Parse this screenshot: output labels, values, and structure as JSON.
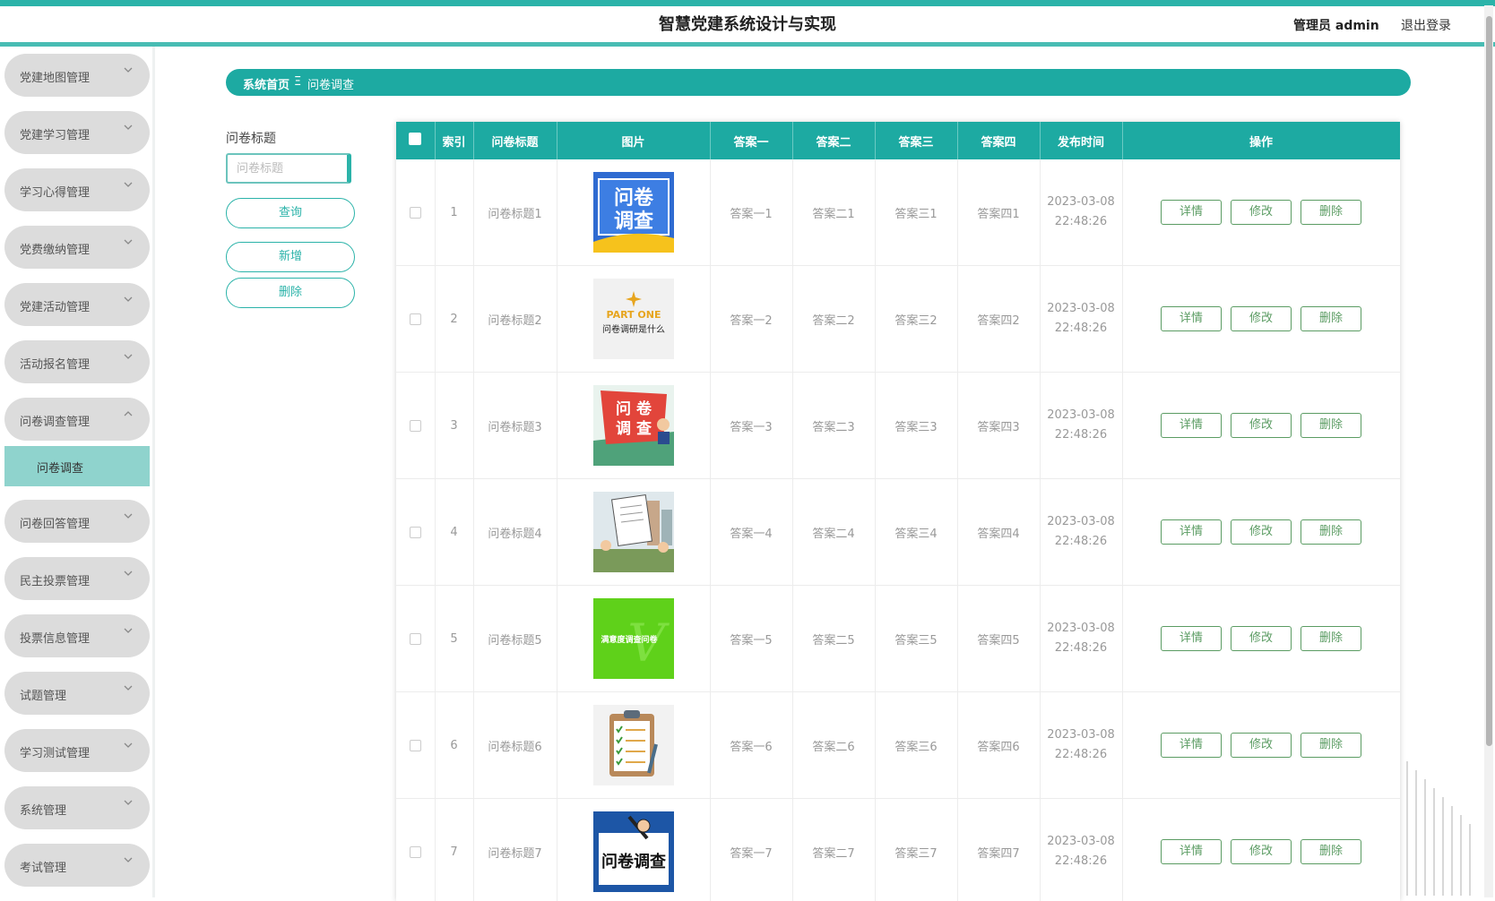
{
  "header": {
    "title": "智慧党建系统设计与实现",
    "user": "管理员 admin",
    "logout": "退出登录"
  },
  "sidebar": {
    "items": [
      {
        "label": "党建地图管理"
      },
      {
        "label": "党建学习管理"
      },
      {
        "label": "学习心得管理"
      },
      {
        "label": "党费缴纳管理"
      },
      {
        "label": "党建活动管理"
      },
      {
        "label": "活动报名管理"
      },
      {
        "label": "问卷调查管理",
        "expanded": true
      },
      {
        "label": "问卷回答管理"
      },
      {
        "label": "民主投票管理"
      },
      {
        "label": "投票信息管理"
      },
      {
        "label": "试题管理"
      },
      {
        "label": "学习测试管理"
      },
      {
        "label": "系统管理"
      },
      {
        "label": "考试管理"
      }
    ],
    "active_sub": "问卷调查"
  },
  "breadcrumb": {
    "home": "系统首页",
    "sep": "Ξ",
    "current": "问卷调查"
  },
  "search": {
    "label": "问卷标题",
    "placeholder": "问卷标题",
    "query_button": "查询",
    "add_button": "新增",
    "delete_button": "删除"
  },
  "table": {
    "headers": [
      "索引",
      "问卷标题",
      "图片",
      "答案一",
      "答案二",
      "答案三",
      "答案四",
      "发布时间",
      "操作"
    ],
    "actions": {
      "detail": "详情",
      "edit": "修改",
      "delete": "删除"
    },
    "rows": [
      {
        "index": "1",
        "title": "问卷标题1",
        "image_icon": "survey-poster-blue",
        "a1": "答案一1",
        "a2": "答案二1",
        "a3": "答案三1",
        "a4": "答案四1",
        "date": "2023-03-08",
        "time": "22:48:26"
      },
      {
        "index": "2",
        "title": "问卷标题2",
        "image_icon": "part-one-poster",
        "image_text": [
          "PART ONE",
          "问卷调研是什么"
        ],
        "a1": "答案一2",
        "a2": "答案二2",
        "a3": "答案三2",
        "a4": "答案四2",
        "date": "2023-03-08",
        "time": "22:48:26"
      },
      {
        "index": "3",
        "title": "问卷标题3",
        "image_icon": "survey-poster-red",
        "a1": "答案一3",
        "a2": "答案二3",
        "a3": "答案三3",
        "a4": "答案四3",
        "date": "2023-03-08",
        "time": "22:48:26"
      },
      {
        "index": "4",
        "title": "问卷标题4",
        "image_icon": "street-survey-illustration",
        "a1": "答案一4",
        "a2": "答案二4",
        "a3": "答案三4",
        "a4": "答案四4",
        "date": "2023-03-08",
        "time": "22:48:26"
      },
      {
        "index": "5",
        "title": "问卷标题5",
        "image_icon": "green-survey-banner",
        "image_text": [
          "满意度调查问卷"
        ],
        "a1": "答案一5",
        "a2": "答案二5",
        "a3": "答案三5",
        "a4": "答案四5",
        "date": "2023-03-08",
        "time": "22:48:26"
      },
      {
        "index": "6",
        "title": "问卷标题6",
        "image_icon": "clipboard-checklist",
        "a1": "答案一6",
        "a2": "答案二6",
        "a3": "答案三6",
        "a4": "答案四6",
        "date": "2023-03-08",
        "time": "22:48:26"
      },
      {
        "index": "7",
        "title": "问卷标题7",
        "image_icon": "survey-poster-pen",
        "a1": "答案一7",
        "a2": "答案二7",
        "a3": "答案三7",
        "a4": "答案四7",
        "date": "2023-03-08",
        "time": "22:48:26"
      }
    ]
  },
  "colors": {
    "accent": "#1daaa2",
    "accent_light": "#8fd3cd",
    "sidebar_item": "#dcdcdc",
    "action_green": "#5b9c63"
  }
}
